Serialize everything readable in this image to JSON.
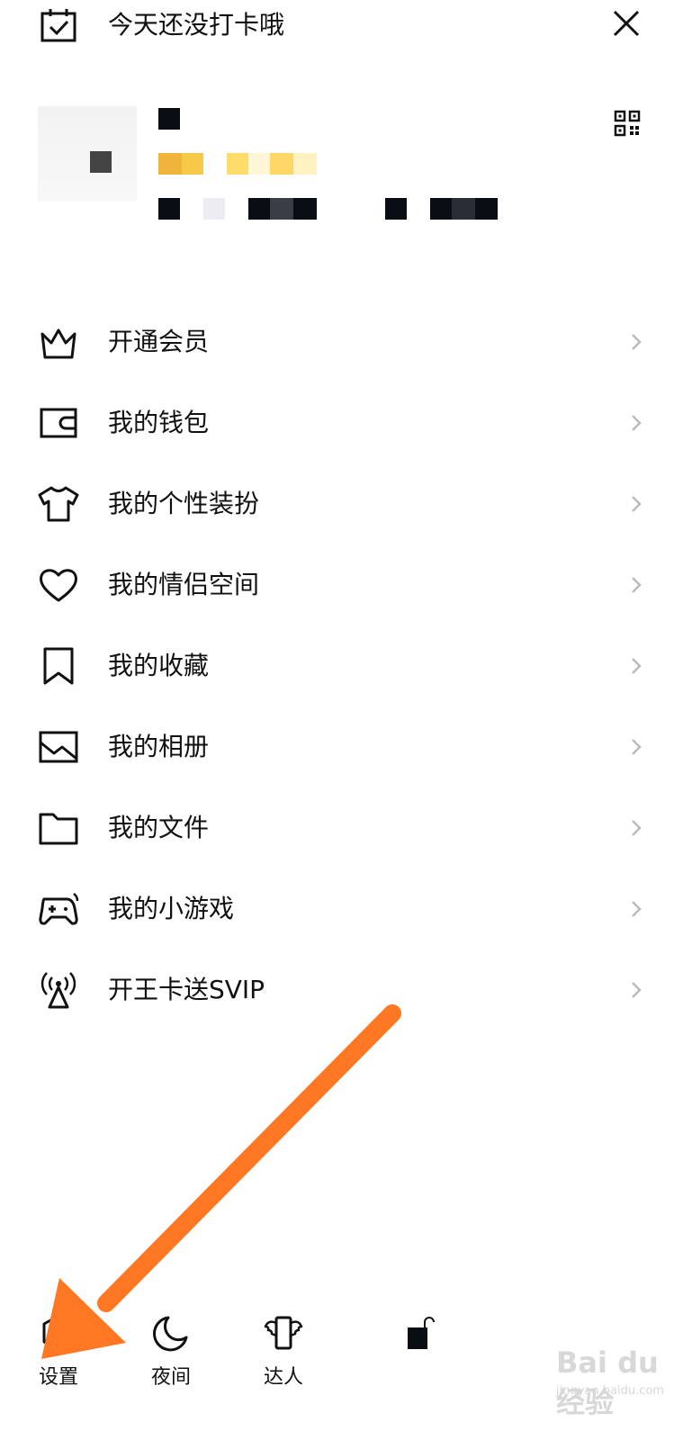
{
  "header": {
    "checkin_text": "今天还没打卡哦"
  },
  "menu": {
    "items": [
      {
        "label": "开通会员",
        "icon": "crown-icon"
      },
      {
        "label": "我的钱包",
        "icon": "wallet-icon"
      },
      {
        "label": "我的个性装扮",
        "icon": "tshirt-icon"
      },
      {
        "label": "我的情侣空间",
        "icon": "heart-icon"
      },
      {
        "label": "我的收藏",
        "icon": "bookmark-icon"
      },
      {
        "label": "我的相册",
        "icon": "photo-album-icon"
      },
      {
        "label": "我的文件",
        "icon": "folder-icon"
      },
      {
        "label": "我的小游戏",
        "icon": "gamepad-icon"
      },
      {
        "label": "开王卡送SVIP",
        "icon": "signal-tower-icon"
      }
    ]
  },
  "bottom": {
    "settings_label": "设置",
    "night_label": "夜间",
    "expert_label": "达人"
  },
  "watermark": {
    "brand": "Bai du 经验",
    "url": "jingyan.baidu.com"
  },
  "colors": {
    "accent_arrow": "#FF7722",
    "text": "#111111",
    "chevron": "#bbbbbb"
  }
}
